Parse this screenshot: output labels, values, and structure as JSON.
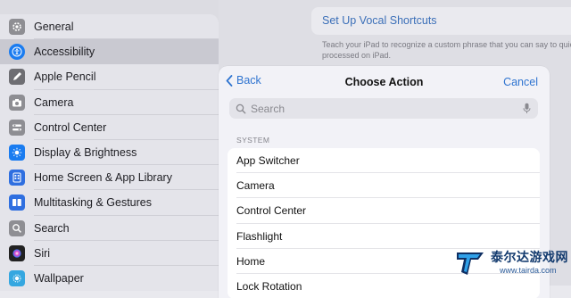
{
  "sidebar": {
    "items": [
      {
        "label": "General",
        "icon": "gear-icon",
        "color": "#8e8e93"
      },
      {
        "label": "Accessibility",
        "icon": "accessibility-icon",
        "color": "#1a7cf0"
      },
      {
        "label": "Apple Pencil",
        "icon": "pencil-icon",
        "color": "#6e6e73"
      },
      {
        "label": "Camera",
        "icon": "camera-icon",
        "color": "#8e8e93"
      },
      {
        "label": "Control Center",
        "icon": "control-center-icon",
        "color": "#8e8e93"
      },
      {
        "label": "Display & Brightness",
        "icon": "brightness-icon",
        "color": "#1a7cf0"
      },
      {
        "label": "Home Screen & App Library",
        "icon": "home-screen-icon",
        "color": "#2f6fe0"
      },
      {
        "label": "Multitasking & Gestures",
        "icon": "multitasking-icon",
        "color": "#2f6fe0"
      },
      {
        "label": "Search",
        "icon": "search-icon",
        "color": "#8e8e93"
      },
      {
        "label": "Siri",
        "icon": "siri-icon",
        "color": "#222222"
      },
      {
        "label": "Wallpaper",
        "icon": "wallpaper-icon",
        "color": "#35a7e0"
      }
    ],
    "selected": "Accessibility"
  },
  "background": {
    "vocal_link": "Set Up Vocal Shortcuts",
    "vocal_description": "Teach your iPad to recognize a custom phrase that you can say to quickl processed on iPad."
  },
  "modal": {
    "back_label": "Back",
    "title": "Choose Action",
    "cancel_label": "Cancel",
    "search_placeholder": "Search",
    "section_header": "SYSTEM",
    "actions": [
      "App Switcher",
      "Camera",
      "Control Center",
      "Flashlight",
      "Home",
      "Lock Rotation"
    ]
  },
  "watermark": {
    "text": "泰尔达游戏网",
    "url": "www.tairda.com"
  },
  "colors": {
    "accent": "#2f74d0",
    "sidebar_selected": "#c9c9d1"
  }
}
